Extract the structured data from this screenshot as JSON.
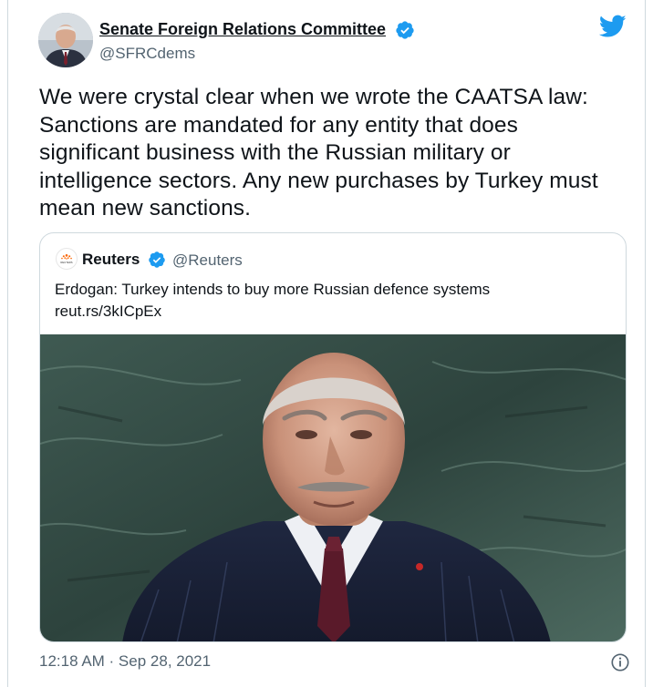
{
  "author": {
    "name": "Senate Foreign Relations Committee",
    "handle": "@SFRCdems"
  },
  "tweet": {
    "lines": [
      "We were crystal clear when we wrote the CAATSA law:",
      "Sanctions are mandated for any entity that does",
      "significant business with the Russian military or",
      "intelligence sectors. Any new purchases by Turkey must",
      "mean new sanctions."
    ]
  },
  "quoted_tweet": {
    "name": "Reuters",
    "handle": "@Reuters",
    "text": "Erdogan: Turkey intends to buy more Russian defence systems",
    "link": "reut.rs/3kICpEx",
    "avatar_text": "REUTERS"
  },
  "timestamp": "12:18 AM · Sep 28, 2021",
  "icons": {
    "verified": "verified-badge-icon",
    "brand": "twitter-bird-icon",
    "info": "info-icon"
  },
  "colors": {
    "verified_blue": "#1d9bf0",
    "twitter_blue": "#1d9bf0",
    "text_primary": "#0f1419",
    "text_secondary": "#536471",
    "border": "#cfd9de",
    "reuters_orange": "#fa6400"
  }
}
